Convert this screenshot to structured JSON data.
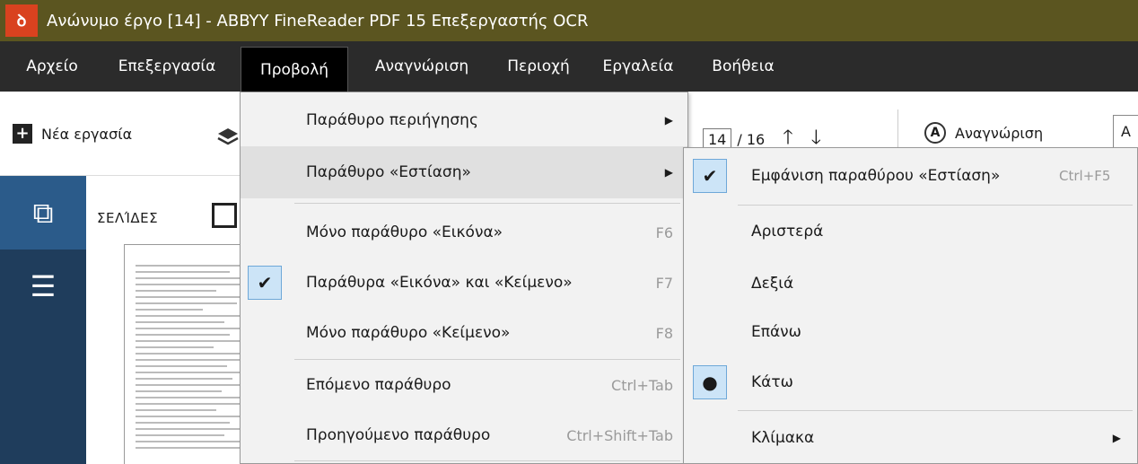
{
  "titlebar": {
    "logo": "ꝺ",
    "title": "Ανώνυμο έργο [14] - ABBYY FineReader PDF 15 Επεξεργαστής OCR"
  },
  "menubar": {
    "items": [
      {
        "label": "Αρχείο"
      },
      {
        "label": "Επεξεργασία"
      },
      {
        "label": "Προβολή"
      },
      {
        "label": "Αναγνώριση"
      },
      {
        "label": "Περιοχή"
      },
      {
        "label": "Εργαλεία"
      },
      {
        "label": "Βοήθεια"
      }
    ]
  },
  "toolbar": {
    "new_task": "Νέα εργασία",
    "page_current": "14",
    "page_total": "/ 16",
    "recognize": "Αναγνώριση",
    "lang_partial": "Α"
  },
  "pages_panel": {
    "label": "ΣΕΛΊΔΕΣ"
  },
  "view_menu": {
    "items": [
      {
        "label": "Παράθυρο περιήγησης",
        "submenu": true
      },
      {
        "label": "Παράθυρο «Εστίαση»",
        "submenu": true
      },
      {
        "label": "Μόνο παράθυρο «Εικόνα»",
        "shortcut": "F6"
      },
      {
        "label": "Παράθυρα «Εικόνα» και «Κείμενο»",
        "shortcut": "F7",
        "checked": true
      },
      {
        "label": "Μόνο παράθυρο «Κείμενο»",
        "shortcut": "F8"
      },
      {
        "label": "Επόμενο παράθυρο",
        "shortcut": "Ctrl+Tab"
      },
      {
        "label": "Προηγούμενο παράθυρο",
        "shortcut": "Ctrl+Shift+Tab"
      }
    ]
  },
  "focus_submenu": {
    "items": [
      {
        "label": "Εμφάνιση παραθύρου «Εστίαση»",
        "shortcut": "Ctrl+F5",
        "checked": true
      },
      {
        "label": "Αριστερά"
      },
      {
        "label": "Δεξιά"
      },
      {
        "label": "Επάνω"
      },
      {
        "label": "Κάτω",
        "radio": true
      },
      {
        "label": "Κλίμακα",
        "submenu": true
      }
    ]
  }
}
